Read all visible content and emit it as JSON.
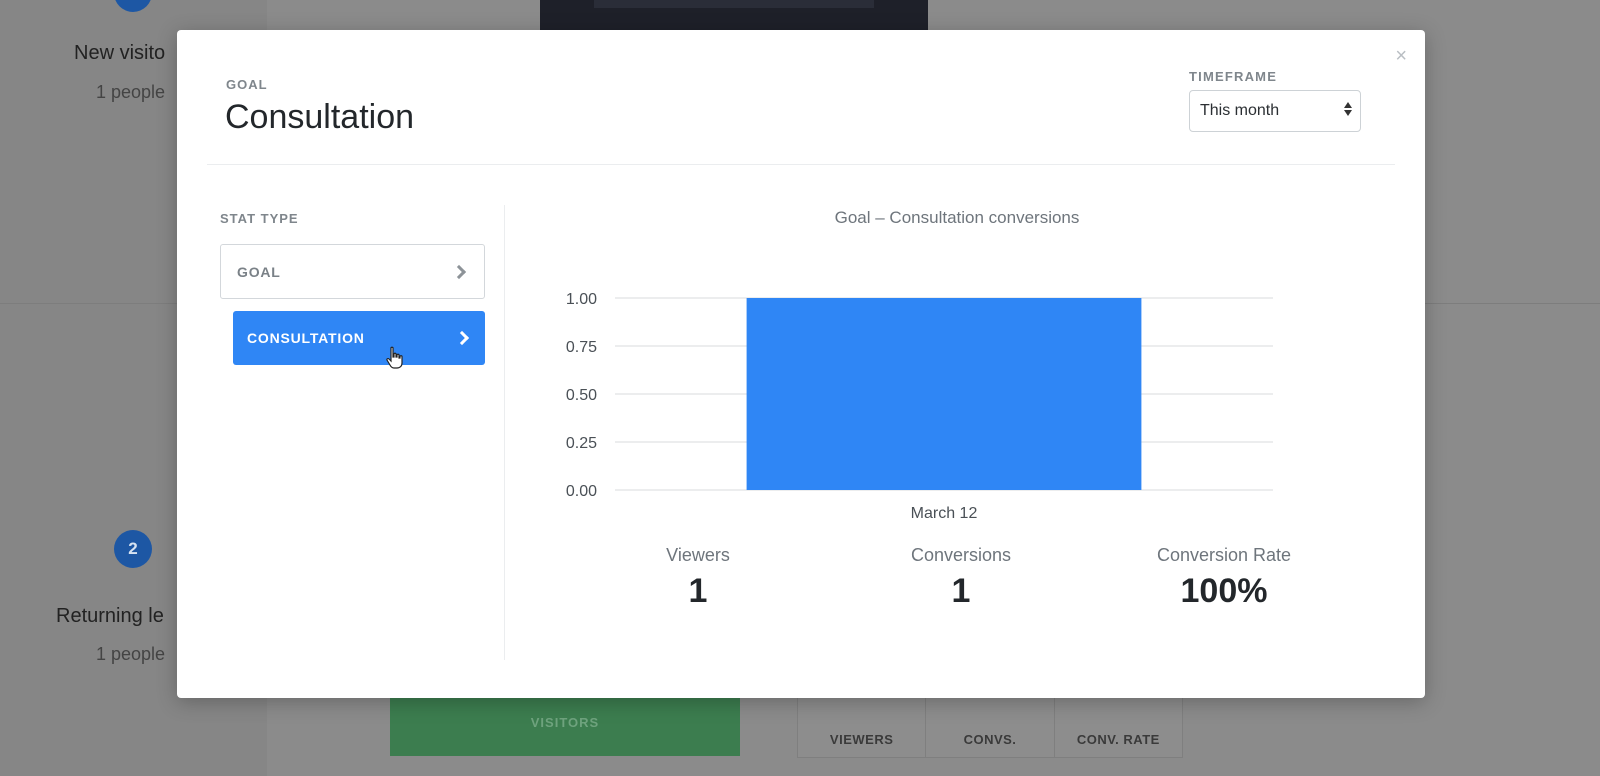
{
  "background": {
    "step1_badge": "",
    "step1_title": "New visito",
    "step1_sub": "1 people",
    "step2_badge": "2",
    "step2_title": "Returning le",
    "step2_sub": "1 people",
    "visitors_label": "VISITORS",
    "stats": [
      "VIEWERS",
      "CONVS.",
      "CONV. RATE"
    ]
  },
  "modal": {
    "close_label": "×",
    "goal_label": "GOAL",
    "goal_title": "Consultation",
    "timeframe_label": "TIMEFRAME",
    "timeframe_value": "This month",
    "stat_type_label": "STAT TYPE",
    "stat_items": [
      {
        "label": "GOAL",
        "active": false
      },
      {
        "label": "CONSULTATION",
        "active": true
      }
    ],
    "summary": [
      {
        "label": "Viewers",
        "value": "1"
      },
      {
        "label": "Conversions",
        "value": "1"
      },
      {
        "label": "Conversion Rate",
        "value": "100%"
      }
    ]
  },
  "colors": {
    "accent": "#2f86f5",
    "bar": "#2f86f5",
    "grid": "#d8dbde"
  },
  "icons": {
    "close": "close-icon",
    "chevron": "chevron-right-icon",
    "cursor": "hand-pointer-icon",
    "select_arrows": "select-arrows-icon"
  },
  "chart_data": {
    "type": "bar",
    "title": "Goal – Consultation conversions",
    "categories": [
      "March 12"
    ],
    "values": [
      1
    ],
    "yticks": [
      "0.00",
      "0.25",
      "0.50",
      "0.75",
      "1.00"
    ],
    "ylim": [
      0,
      1
    ],
    "grid": true,
    "legend": "none"
  }
}
